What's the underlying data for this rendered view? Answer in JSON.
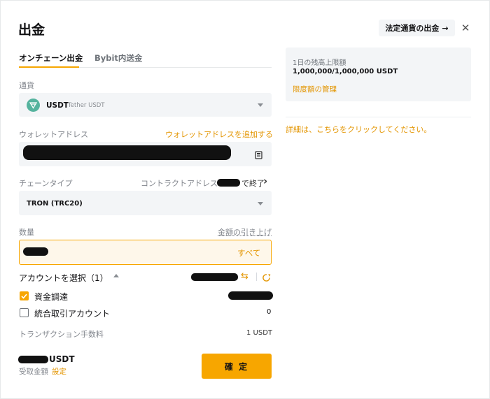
{
  "header": {
    "title": "出金",
    "fiat_withdraw_label": "法定通貨の出金",
    "fiat_arrow": "→",
    "close_glyph": "✕"
  },
  "tabs": [
    {
      "label": "オンチェーン出金",
      "active": true
    },
    {
      "label": "Bybit内送金",
      "active": false
    }
  ],
  "currency": {
    "label": "通貨",
    "symbol": "USDT",
    "name": "Tether USDT"
  },
  "wallet": {
    "label": "ウォレットアドレス",
    "add_link": "ウォレットアドレスを追加する"
  },
  "chain": {
    "label": "チェーンタイプ",
    "contract_link": "コントラクトアドレス",
    "contract_suffix": "で終了",
    "contract_chevron": "›",
    "value": "TRON (TRC20)"
  },
  "amount": {
    "label": "数量",
    "raise_limit": "金額の引き上げ",
    "all_button": "すべて"
  },
  "accounts": {
    "label": "アカウントを選択（1）",
    "items": [
      {
        "label": "資金調達",
        "checked": true,
        "value": ""
      },
      {
        "label": "統合取引アカウント",
        "checked": false,
        "value": "0"
      }
    ]
  },
  "fee": {
    "label": "トランザクション手数料",
    "value": "1 USDT"
  },
  "receive": {
    "currency": "USDT",
    "label": "受取金額",
    "settings_link": "設定"
  },
  "confirm_label": "確 定",
  "side": {
    "limit_title": "1日の残高上限額",
    "limit_value": "1,000,000/1,000,000 USDT",
    "limit_manage": "限度額の管理",
    "details_link": "詳細は、こちらをクリックしてください。"
  },
  "colors": {
    "accent": "#f7a600",
    "link": "#e39500",
    "coin": "#55b39e"
  }
}
